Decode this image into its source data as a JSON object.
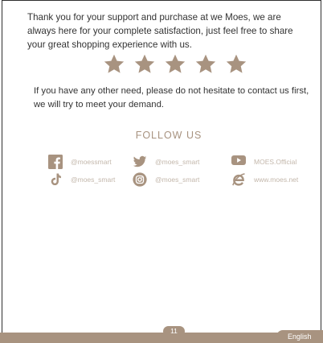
{
  "intro_text": "Thank you for your support and purchase at we Moes, we are always here for your complete satisfaction, just feel free to share your great shopping experience with us.",
  "rating": {
    "stars": 5,
    "of": 5,
    "color": "#a89380"
  },
  "contact_text": "If you have any other need, please do not hesitate to contact us first, we will try to meet your demand.",
  "follow_heading": "FOLLOW US",
  "social": [
    {
      "icon": "facebook-icon",
      "handle": "@moessmart"
    },
    {
      "icon": "twitter-icon",
      "handle": "@moes_smart"
    },
    {
      "icon": "youtube-icon",
      "handle": "MOES.Official"
    },
    {
      "icon": "tiktok-icon",
      "handle": "@moes_smart"
    },
    {
      "icon": "instagram-icon",
      "handle": "@moes_smart"
    },
    {
      "icon": "browser-icon",
      "handle": "www.moes.net"
    }
  ],
  "footer": {
    "page_number": "11",
    "language": "English"
  },
  "colors": {
    "accent": "#a89380",
    "text": "#333333",
    "handle": "#c3b7ab"
  }
}
